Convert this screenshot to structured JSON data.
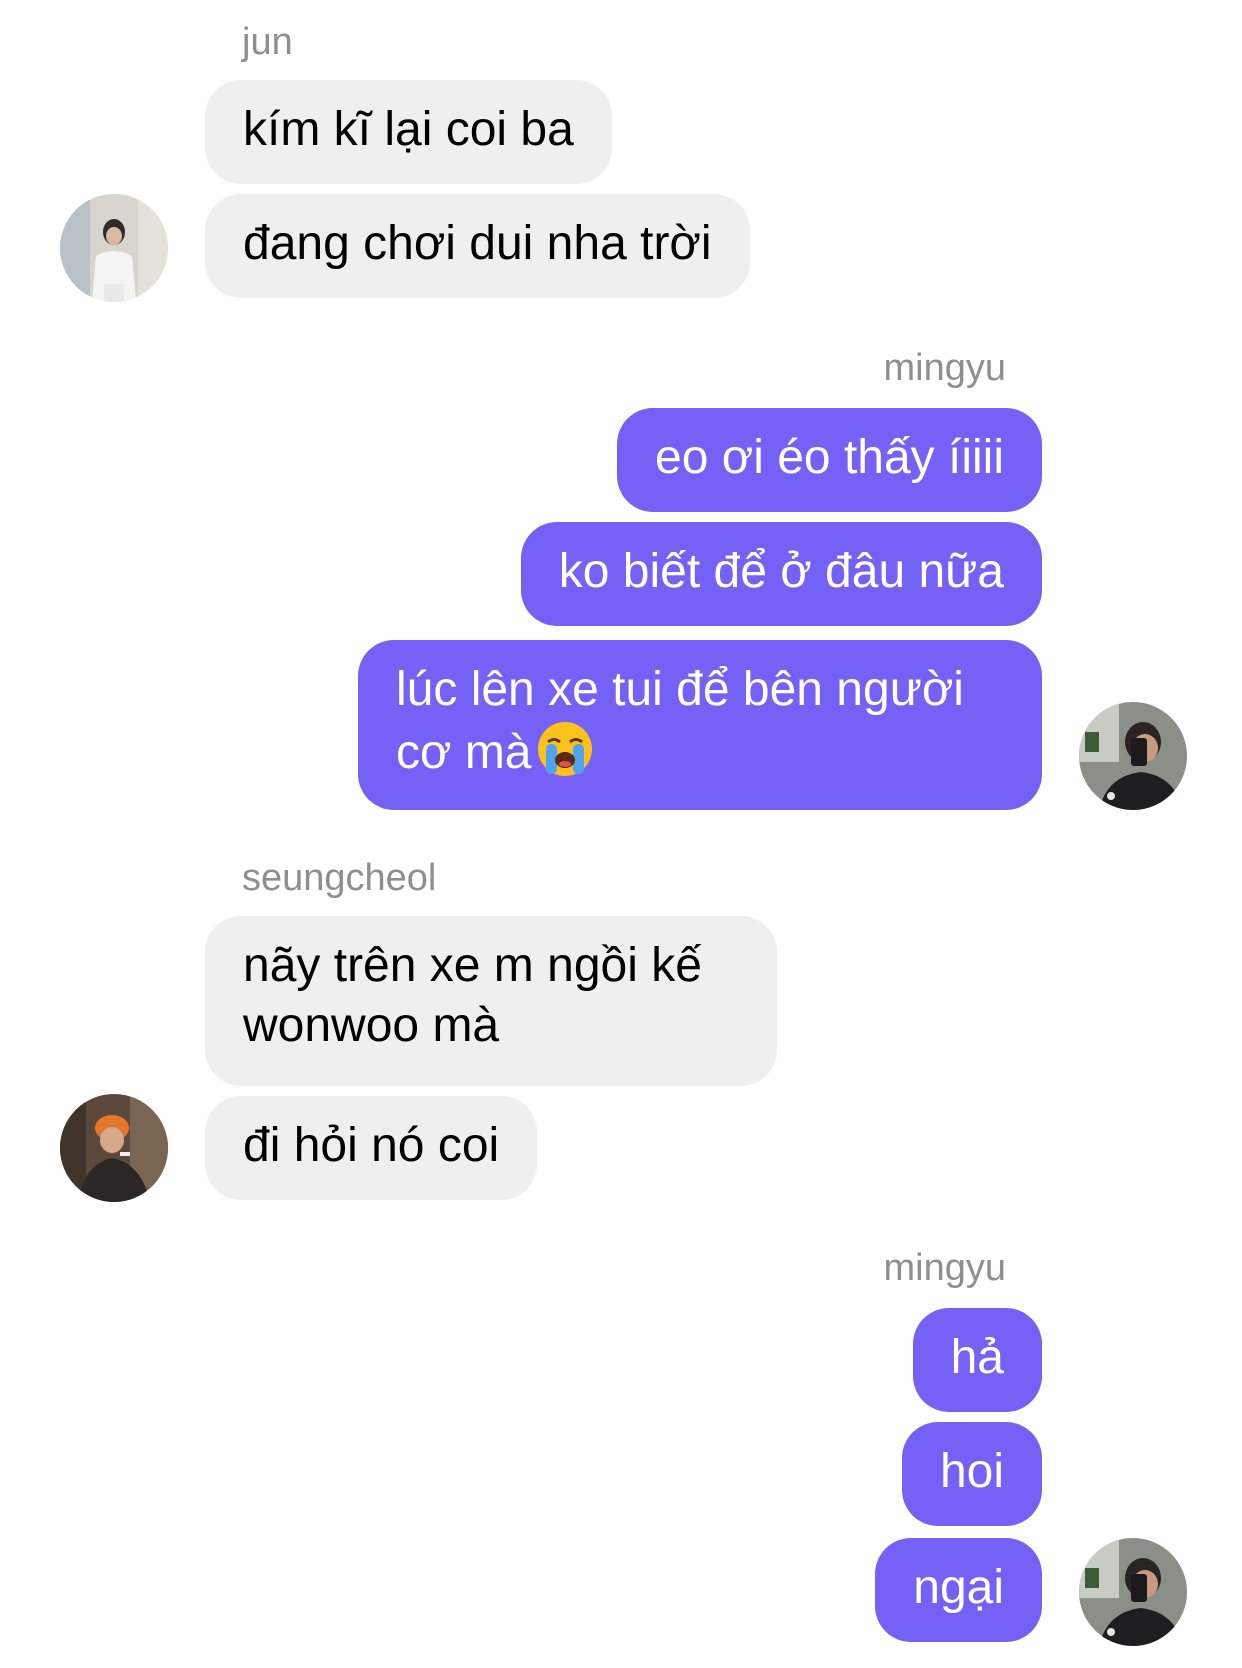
{
  "colors": {
    "incoming_bubble": "#efefef",
    "outgoing_bubble": "#7561f5",
    "sender_name": "#8e8e93"
  },
  "groups": [
    {
      "sender": "jun",
      "direction": "incoming",
      "avatar": "jun-avatar",
      "messages": [
        "kím kĩ lại coi ba",
        "đang chơi dui nha trời"
      ]
    },
    {
      "sender": "mingyu",
      "direction": "outgoing",
      "avatar": "mingyu-avatar",
      "messages": [
        "eo ơi éo thấy íiiii",
        "ko biết để ở đâu nữa",
        "lúc lên xe tui để bên người cơ mà"
      ],
      "emoji": "loudly-crying-face"
    },
    {
      "sender": "seungcheol",
      "direction": "incoming",
      "avatar": "seungcheol-avatar",
      "messages": [
        "nãy trên xe m ngồi kế wonwoo mà",
        "đi hỏi nó coi"
      ]
    },
    {
      "sender": "mingyu",
      "direction": "outgoing",
      "avatar": "mingyu-avatar",
      "messages": [
        "hả",
        "hoi",
        "ngại"
      ]
    }
  ]
}
